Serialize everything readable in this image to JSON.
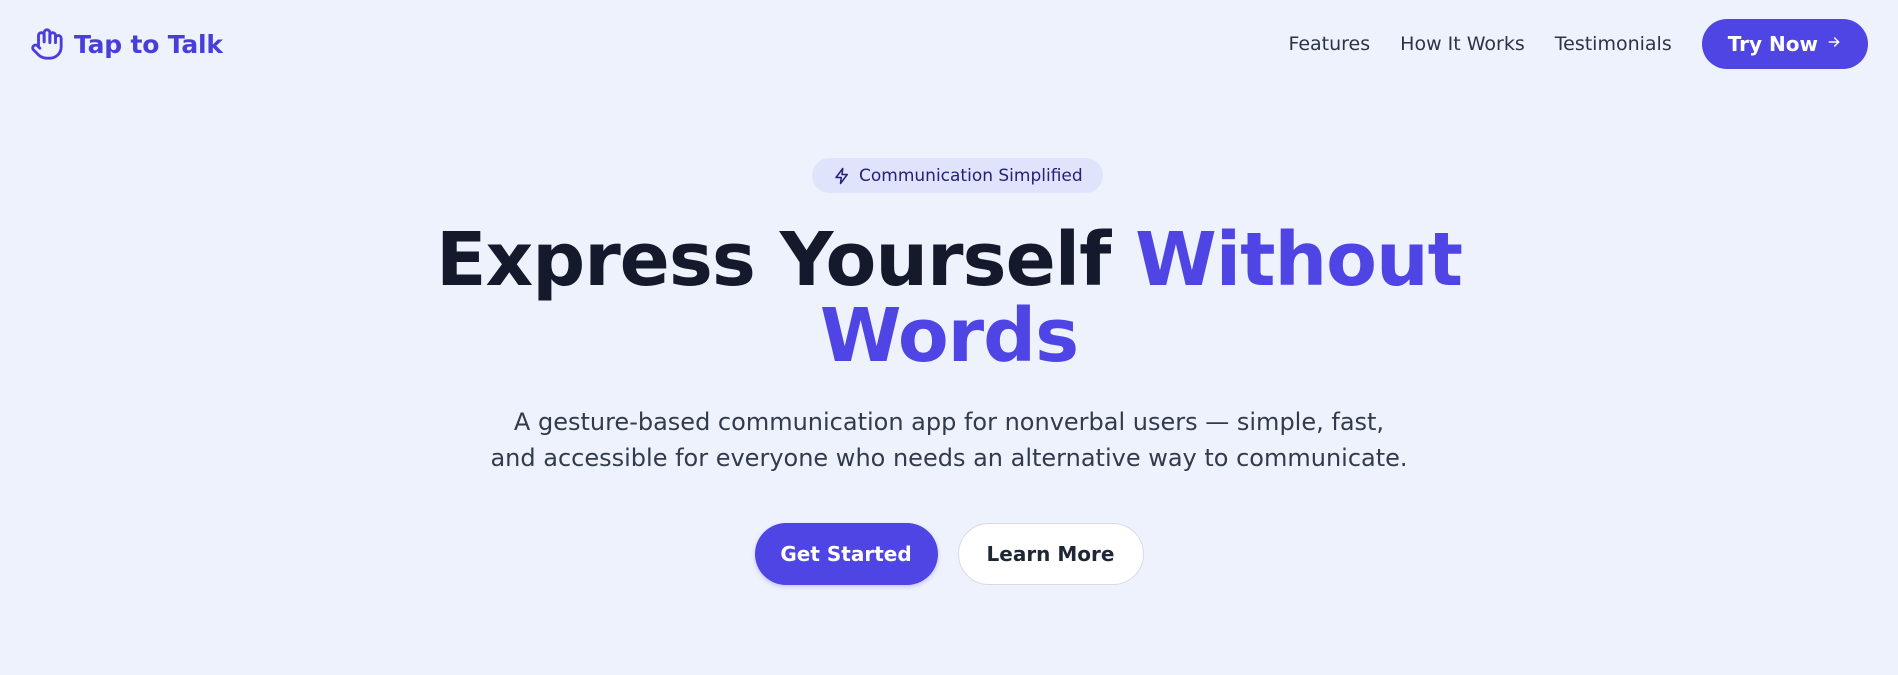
{
  "brand": {
    "name": "Tap to Talk",
    "icon": "hand-icon"
  },
  "nav": {
    "links": [
      "Features",
      "How It Works",
      "Testimonials"
    ],
    "cta_label": "Try Now",
    "cta_icon": "arrow-right-icon"
  },
  "hero": {
    "badge": {
      "text": "Communication Simplified",
      "icon": "lightning-icon"
    },
    "headline": {
      "part1": "Express Yourself",
      "accent_line1": "Without",
      "accent_line2": "Words"
    },
    "subtitle_line1": "A gesture-based communication app for nonverbal users — simple, fast,",
    "subtitle_line2": "and accessible for everyone who needs an alternative way to communicate.",
    "primary_cta": "Get Started",
    "secondary_cta": "Learn More"
  },
  "colors": {
    "accent": "#4f45e4",
    "background": "#eef2fd",
    "heading": "#141a2b",
    "badge_bg": "#dfe3fb"
  }
}
